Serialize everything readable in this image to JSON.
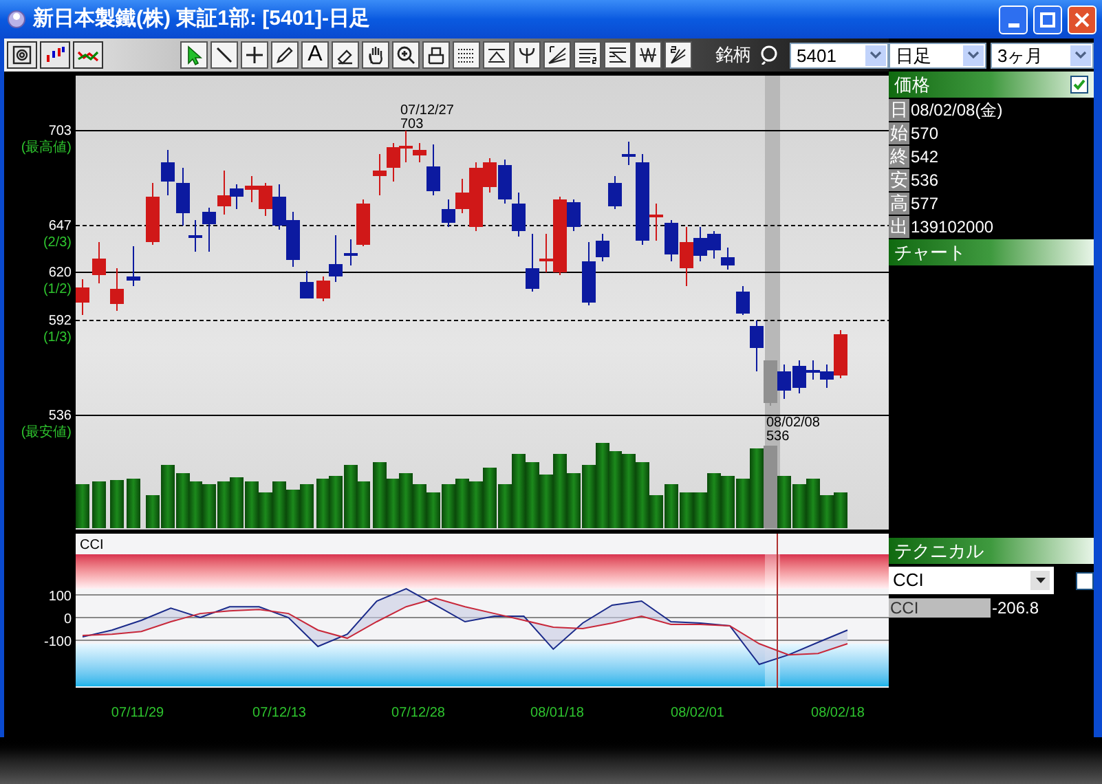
{
  "window": {
    "title": "新日本製鐵(株) 東証1部: [5401]-日足"
  },
  "toolbar": {
    "text_tool": "A",
    "symbol_label": "銘柄",
    "symbol": "5401",
    "interval": "日足",
    "range": "3ヶ月"
  },
  "price_chart": {
    "levels": [
      {
        "value": "703",
        "note": "(最高値)",
        "kind": "solid"
      },
      {
        "value": "647",
        "note": "(2/3)",
        "kind": "dashed"
      },
      {
        "value": "620",
        "note": "(1/2)",
        "kind": "solid"
      },
      {
        "value": "592",
        "note": "(1/3)",
        "kind": "dashed"
      },
      {
        "value": "536",
        "note": "(最安値)",
        "kind": "solid"
      }
    ],
    "high_marker": {
      "date": "07/12/27",
      "price": "703"
    },
    "low_marker": {
      "date": "08/02/08",
      "price": "536"
    }
  },
  "cci_panel": {
    "chart_data": {
      "type": "line",
      "title": "CCI",
      "ylim": [
        -309,
        370
      ],
      "yticks": [
        100,
        0,
        -100
      ],
      "grid": true,
      "series": [
        {
          "color": "#1a2a8a",
          "values": [
            -85,
            -55,
            -12,
            42,
            0,
            48,
            48,
            0,
            -127,
            -73,
            73,
            127,
            55,
            -18,
            6,
            6,
            -139,
            -24,
            55,
            73,
            -18,
            -24,
            -36,
            -206,
            -164,
            -109,
            -55
          ]
        },
        {
          "color": "#c8283a",
          "values": [
            -79,
            -73,
            -61,
            -18,
            18,
            30,
            36,
            18,
            -55,
            -91,
            -18,
            48,
            85,
            48,
            18,
            -12,
            -42,
            -48,
            -24,
            6,
            -30,
            -30,
            -36,
            -115,
            -164,
            -158,
            -115
          ]
        }
      ]
    }
  },
  "dates": [
    "07/11/29",
    "07/12/13",
    "07/12/28",
    "08/01/18",
    "08/02/01",
    "08/02/18"
  ],
  "side_panel": {
    "price": {
      "title": "価格",
      "checked": true,
      "rows": [
        {
          "label": "日",
          "value": "08/02/08(金)"
        },
        {
          "label": "始",
          "value": "570"
        },
        {
          "label": "終",
          "value": "542"
        },
        {
          "label": "安",
          "value": "536"
        },
        {
          "label": "高",
          "value": "577"
        },
        {
          "label": "出",
          "value": "139102000"
        }
      ]
    },
    "chart": {
      "title": "チャート"
    },
    "technical": {
      "title": "テクニカル",
      "indicator": "CCI",
      "checked": false,
      "readings": [
        {
          "name": "CCI",
          "value": "-206.8"
        }
      ]
    }
  }
}
